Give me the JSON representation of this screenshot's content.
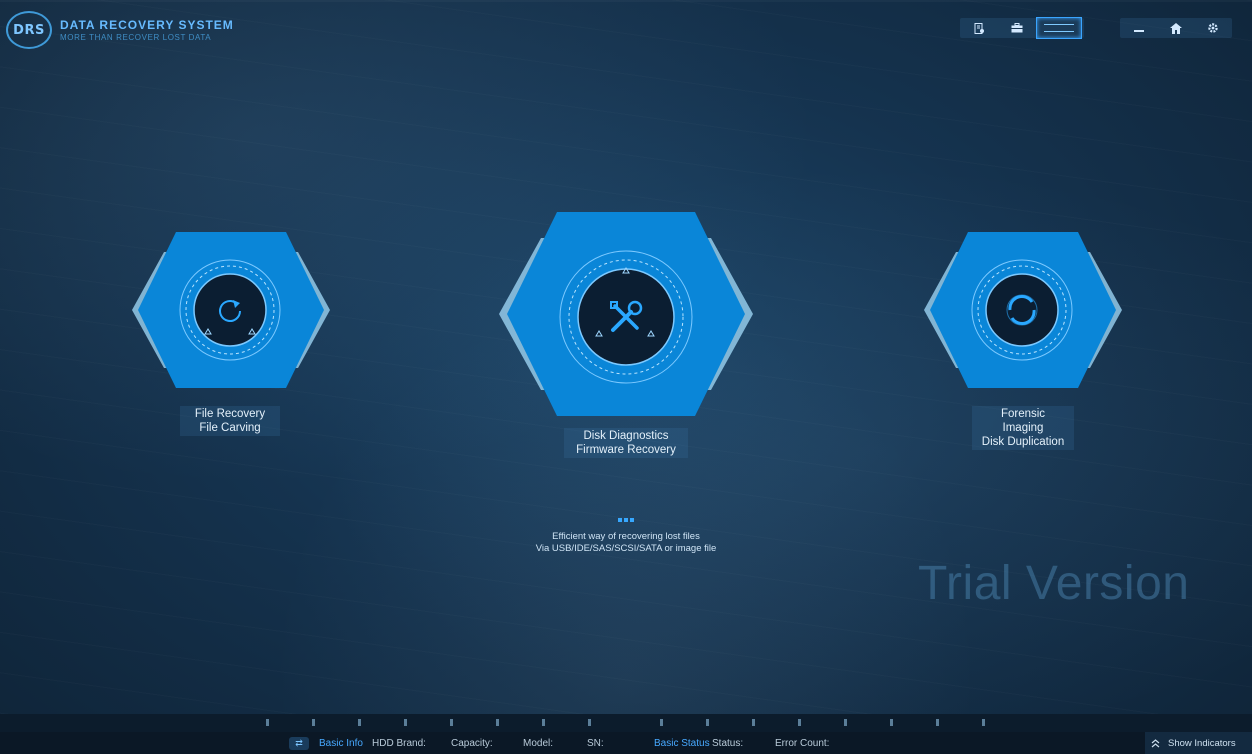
{
  "header": {
    "logo_badge": "DRS",
    "title": "DATA RECOVERY SYSTEM",
    "subtitle": "MORE THAN RECOVER LOST DATA"
  },
  "modules": [
    {
      "line1": "File Recovery",
      "line2": "File Carving"
    },
    {
      "line1": "Disk Diagnostics",
      "line2": "Firmware Recovery"
    },
    {
      "line1": "Forensic Imaging",
      "line2": "Disk Duplication"
    }
  ],
  "tagline": {
    "line1": "Efficient way of recovering lost files",
    "line2": "Via USB/IDE/SAS/SCSI/SATA or image file"
  },
  "watermark": "Trial Version",
  "statusbar": {
    "basic_info": "Basic Info",
    "hdd_brand": "HDD Brand:",
    "capacity": "Capacity:",
    "model": "Model:",
    "sn": "SN:",
    "basic_status": "Basic Status",
    "status": "Status:",
    "error_count": "Error Count:",
    "show_indicators": "Show Indicators"
  },
  "colors": {
    "accent": "#37a8ff",
    "hex_fill": "#0a86d8",
    "background": "#15334f"
  }
}
